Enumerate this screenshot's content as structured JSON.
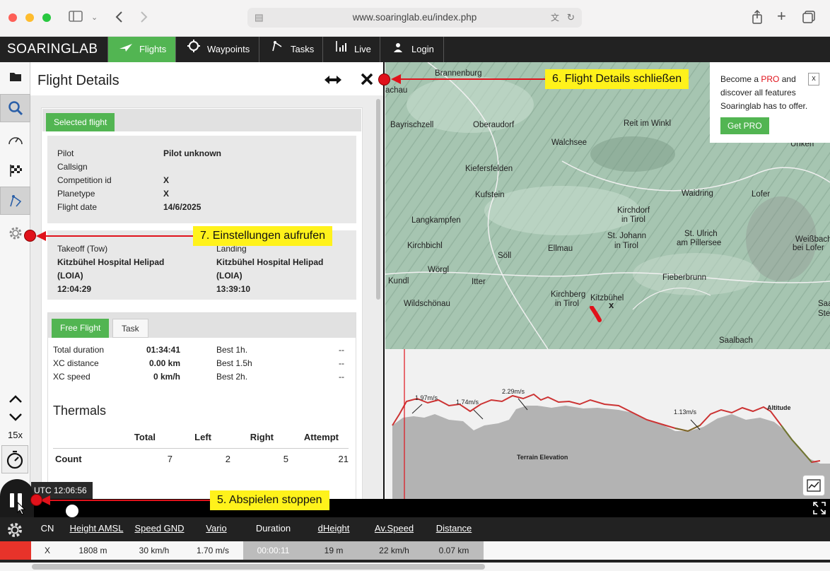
{
  "browser": {
    "url": "www.soaringlab.eu/index.php"
  },
  "nav": {
    "brand": "SOARINGLAB",
    "items": [
      {
        "label": "Flights",
        "active": true
      },
      {
        "label": "Waypoints"
      },
      {
        "label": "Tasks"
      },
      {
        "label": "Live"
      },
      {
        "label": "Login"
      }
    ]
  },
  "sidebar": {
    "speed": "15x"
  },
  "panel": {
    "title": "Flight Details",
    "selected_flight_tab": "Selected flight",
    "details": [
      {
        "label": "Pilot",
        "value": "Pilot unknown"
      },
      {
        "label": "Callsign",
        "value": ""
      },
      {
        "label": "Competition id",
        "value": "X"
      },
      {
        "label": "Planetype",
        "value": "X"
      },
      {
        "label": "Flight date",
        "value": "14/6/2025"
      }
    ],
    "takeoff": {
      "label": "Takeoff  (Tow)",
      "place": "Kitzbühel Hospital Helipad",
      "code": "(LOIA)",
      "time": "12:04:29"
    },
    "landing": {
      "label": "Landing",
      "place": "Kitzbühel Hospital Helipad",
      "code": "(LOIA)",
      "time": "13:39:10"
    },
    "tabs": [
      "Free Flight",
      "Task"
    ],
    "stats_left": [
      {
        "label": "Total duration",
        "value": "01:34:41"
      },
      {
        "label": "XC distance",
        "value": "0.00 km"
      },
      {
        "label": "XC speed",
        "value": "0 km/h"
      }
    ],
    "stats_right": [
      {
        "label": "Best 1h.",
        "value": "--"
      },
      {
        "label": "Best 1.5h",
        "value": "--"
      },
      {
        "label": "Best 2h.",
        "value": "--"
      }
    ],
    "thermals": {
      "title": "Thermals",
      "headers": [
        "Total",
        "Left",
        "Right",
        "Attempt"
      ],
      "row_label": "Count",
      "row_values": [
        "7",
        "2",
        "5",
        "21"
      ]
    }
  },
  "map": {
    "labels": [
      "Brannenburg",
      "achau",
      "Bayrischzell",
      "Oberaudorf",
      "Walchsee",
      "Reit im Winkl",
      "Unken",
      "Kiefersfelden",
      "Kufstein",
      "Waidring",
      "Lofer",
      "Langkampfen",
      "Kirchdorf",
      "in Tirol",
      "St. Johann",
      "in Tirol",
      "St. Ulrich",
      "am Pillersee",
      "Weißbach",
      "bei Lofer",
      "Kirchbichl",
      "Söll",
      "Ellmau",
      "Wörgl",
      "Fieberbrunn",
      "Kundl",
      "Itter",
      "Kirchberg",
      "in Tirol",
      "Kitzbühel",
      "Wildschönau",
      "Saalbach",
      "Saalf",
      "Ste"
    ],
    "marker": "x",
    "promo": {
      "text1": "Become a ",
      "pro": "PRO",
      "text2": " and discover all features Soaringlab has to offer.",
      "button": "Get PRO",
      "close": "x"
    }
  },
  "elevation": {
    "climbs": [
      "1.97m/s",
      "1.74m/s",
      "2.29m/s",
      "1.13m/s"
    ],
    "altitude_label": "Altitude",
    "terrain_label": "Terrain Elevation"
  },
  "player": {
    "time": "UTC 12:06:56"
  },
  "table": {
    "headers": [
      "CN",
      "Height AMSL",
      "Speed GND",
      "Vario",
      "Duration",
      "dHeight",
      "Av.Speed",
      "Distance"
    ],
    "row": [
      "X",
      "1808 m",
      "30 km/h",
      "1.70 m/s",
      "00:00:11",
      "19 m",
      "22 km/h",
      "0.07 km"
    ],
    "row_color": "#e8332a"
  },
  "callouts": {
    "c5": "5. Abspielen stoppen",
    "c6": "6. Flight Details schließen",
    "c7": "7. Einstellungen aufrufen"
  },
  "colors": {
    "accent": "#52b552",
    "navbar": "#222222",
    "callout": "#fff21b",
    "marker": "#e0121b"
  }
}
